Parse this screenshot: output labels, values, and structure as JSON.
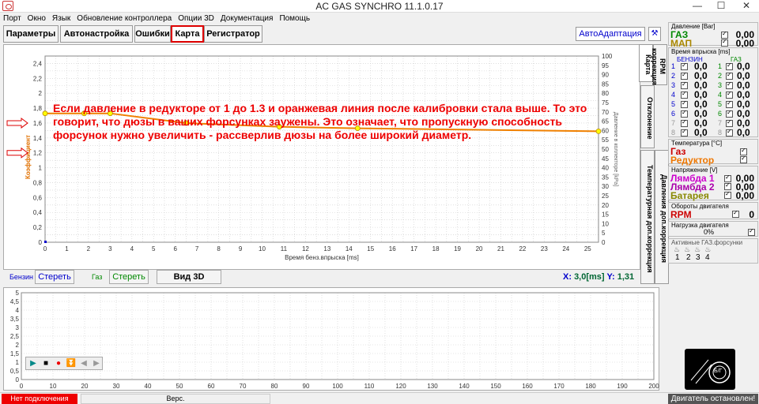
{
  "window": {
    "title": "AC GAS SYNCHRO  11.1.0.17",
    "minimize": "—",
    "maximize": "☐",
    "close": "✕"
  },
  "menu": [
    "Порт",
    "Окно",
    "Язык",
    "Обновление контроллера",
    "Опции 3D",
    "Документация",
    "Помощь"
  ],
  "tabs": [
    "Параметры",
    "Автонастройка",
    "Ошибки",
    "Карта",
    "Регистратор"
  ],
  "active_tab": "Карта",
  "toolbar": {
    "autoadapt": "АвтоАдаптация"
  },
  "vertical_tabs": [
    "Карта",
    "RPM коррекция",
    "Отклонение",
    "Температурная доп.коррекция",
    "Давления доп.коррекция"
  ],
  "annotation": "Если давление в редукторе от 1 до 1.3 и оранжевая линия после калибровки стала выше. То это говорит, что дюзы в ваших форсунках заужены. Это означает, что пропускную способность форсунок нужно увеличить - рассверлив дюзы на более широкий диаметр.",
  "chart_data": {
    "type": "line",
    "xlabel": "Время бенз.впрыска [ms]",
    "ylabel_left": "Коэффициент",
    "ylabel_right": "Давление в коллекторе [kPa]",
    "xlim": [
      0,
      25.5
    ],
    "ylim_left": [
      0,
      2.5
    ],
    "ylim_right": [
      0,
      100
    ],
    "x_ticks": [
      "0",
      "1",
      "2",
      "3",
      "4",
      "5",
      "6",
      "7",
      "8",
      "9",
      "10",
      "11",
      "12",
      "13",
      "14",
      "15",
      "16",
      "17",
      "18",
      "19",
      "20",
      "21",
      "22",
      "23",
      "24",
      "25"
    ],
    "y_ticks_left": [
      "0",
      "0,2",
      "0,4",
      "0,6",
      "0,8",
      "1",
      "1,2",
      "1,4",
      "1,6",
      "1,8",
      "2",
      "2,2",
      "2,4"
    ],
    "y_ticks_right": [
      "0",
      "5",
      "10",
      "15",
      "20",
      "25",
      "30",
      "35",
      "40",
      "45",
      "50",
      "55",
      "60",
      "65",
      "70",
      "75",
      "80",
      "85",
      "90",
      "95",
      "100"
    ],
    "grid": true,
    "series": [
      {
        "color": "#f08000",
        "x": [
          0,
          1.8,
          3.0,
          6.5,
          10.8,
          14.4,
          25.5
        ],
        "y": [
          1.73,
          1.73,
          1.73,
          1.6,
          1.55,
          1.53,
          1.49
        ],
        "markers": [
          0,
          1.8,
          3.0,
          6.5,
          10.8,
          14.4,
          25.5
        ]
      }
    ]
  },
  "controls": {
    "petrol_label": "Бензин",
    "petrol_clear": "Стереть",
    "gas_label": "Газ",
    "gas_clear": "Стереть",
    "view3d": "Вид 3D",
    "x_label": "X:",
    "x_value": "3,0[ms]",
    "y_label": "Y:",
    "y_value": "1,31"
  },
  "log_chart": {
    "y_ticks": [
      "0",
      "0,5",
      "1",
      "1,5",
      "2",
      "2,5",
      "3",
      "3,5",
      "4",
      "4,5",
      "5"
    ],
    "x_ticks": [
      "0",
      "10",
      "20",
      "30",
      "40",
      "50",
      "60",
      "70",
      "80",
      "90",
      "100",
      "110",
      "120",
      "130",
      "140",
      "150",
      "160",
      "170",
      "180",
      "190",
      "200"
    ],
    "ylim": [
      0,
      5
    ],
    "xlim": [
      0,
      200
    ]
  },
  "right_panel": {
    "pressure_title": "Давление [Bar]",
    "gas_label": "ГАЗ",
    "gas_value": "0,00",
    "map_label": "МАП",
    "map_value": "0,00",
    "inj_title": "Время впрыска [ms]",
    "petrol_col": "БЕНЗИН",
    "gas_col": "ГАЗ",
    "injectors": [
      {
        "n": "1",
        "petrol": "0,0",
        "gas": "0,0"
      },
      {
        "n": "2",
        "petrol": "0,0",
        "gas": "0,0"
      },
      {
        "n": "3",
        "petrol": "0,0",
        "gas": "0,0"
      },
      {
        "n": "4",
        "petrol": "0,0",
        "gas": "0,0"
      },
      {
        "n": "5",
        "petrol": "0,0",
        "gas": "0,0"
      },
      {
        "n": "6",
        "petrol": "0,0",
        "gas": "0,0"
      },
      {
        "n": "7",
        "petrol": "0,0",
        "gas": "0,0"
      },
      {
        "n": "8",
        "petrol": "0,0",
        "gas": "0,0"
      }
    ],
    "temp_title": "Температура [°C]",
    "temp_gas": "Газ",
    "temp_reducer": "Редуктор",
    "volt_title": "Напряжение [V]",
    "lambda1": "Лямбда 1",
    "lambda1_value": "0,00",
    "lambda2": "Лямбда 2",
    "lambda2_value": "0,00",
    "battery": "Батарея",
    "battery_value": "0,00",
    "rpm_title": "Обороты двигателя",
    "rpm_label": "RPM",
    "rpm_value": "0",
    "load_title": "Нагрузка двигателя",
    "load_value": "0%",
    "active_title": "Активные ГАЗ.форсунки",
    "active_nums": [
      "1",
      "2",
      "3",
      "4"
    ]
  },
  "statusbar": {
    "connection": "Нет подключения",
    "version": "Верс.",
    "engine": "Двигатель остановлен!"
  },
  "logo_text": "Б/Г",
  "colors": {
    "accent_red": "#e00000",
    "line_orange": "#f08000",
    "link_blue": "#0000cc"
  }
}
